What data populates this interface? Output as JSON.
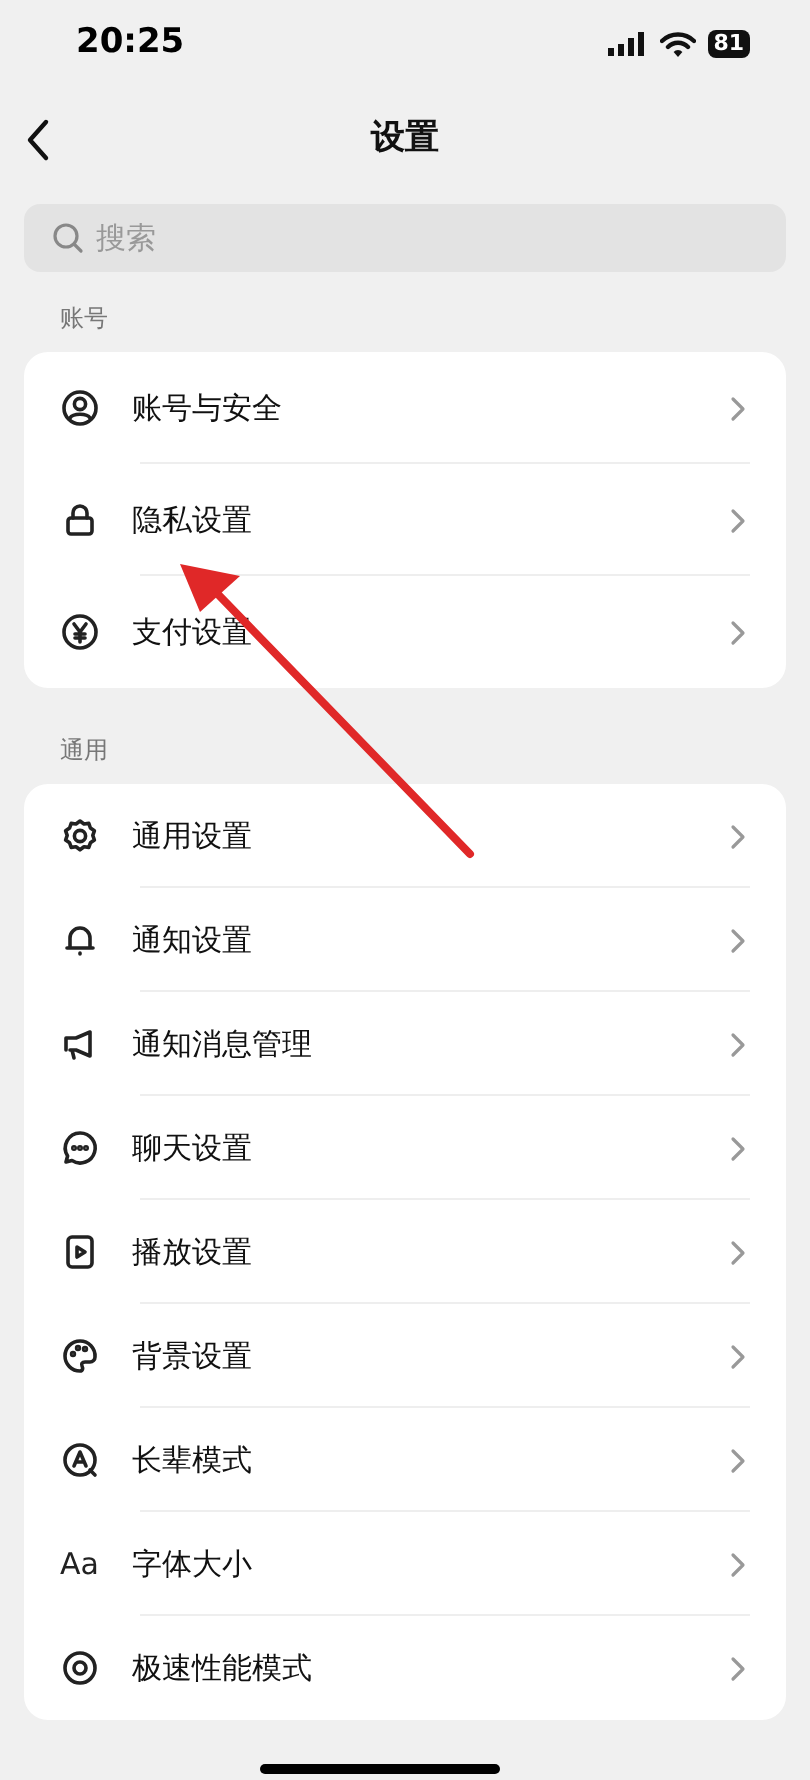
{
  "status_bar": {
    "time": "20:25",
    "battery": "81"
  },
  "header": {
    "title": "设置"
  },
  "search": {
    "placeholder": "搜索"
  },
  "sections": [
    {
      "title": "账号",
      "items": [
        {
          "kind": "user",
          "label": "账号与安全"
        },
        {
          "kind": "lock",
          "label": "隐私设置"
        },
        {
          "kind": "yen",
          "label": "支付设置"
        }
      ]
    },
    {
      "title": "通用",
      "items": [
        {
          "kind": "gear",
          "label": "通用设置"
        },
        {
          "kind": "bell",
          "label": "通知设置"
        },
        {
          "kind": "megaphone",
          "label": "通知消息管理"
        },
        {
          "kind": "chat",
          "label": "聊天设置"
        },
        {
          "kind": "play",
          "label": "播放设置"
        },
        {
          "kind": "palette",
          "label": "背景设置"
        },
        {
          "kind": "elder",
          "label": "长辈模式"
        },
        {
          "kind": "text",
          "icon_text": "Aa",
          "label": "字体大小"
        },
        {
          "kind": "target",
          "label": "极速性能模式"
        }
      ]
    }
  ]
}
